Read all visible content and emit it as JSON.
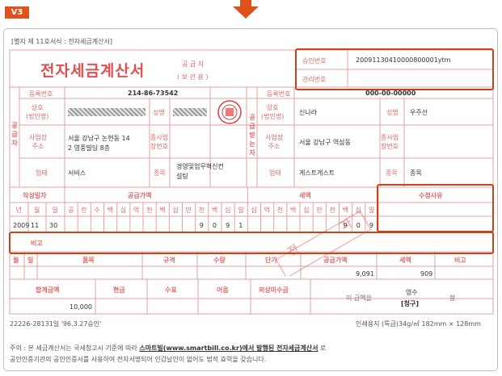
{
  "badge": "V3",
  "form_caption": "[별지 제 11호서식 : 전자세금계산서]",
  "title": "전자세금계산서",
  "supplier_header": {
    "line1": "공 급 자",
    "line2": "( 보 관 용 )"
  },
  "approval": {
    "approval_label": "승인번호",
    "approval_value": "20091130410000800001ytm",
    "manage_label": "관리번호",
    "manage_value": ""
  },
  "supplier": {
    "side_label": "공급자",
    "reg_label": "등록번호",
    "reg_value": "214-86-73542",
    "name_label": "상호\n(법인명)",
    "rep_label": "성명",
    "addr_label": "사업장\n주소",
    "addr_value": "서울 강남구 논현동 14\n2 영풍빌딩 8층",
    "branch_label": "종사업\n장번호",
    "type_label": "업태",
    "type_value": "서비스",
    "item_label": "종목",
    "item_value": "경영및업무혁신컨\n설팅"
  },
  "buyer": {
    "side_label": "공급받는자",
    "reg_label": "등록번호",
    "reg_value": "000-00-00000",
    "name_label": "상호\n(법인명)",
    "name_value": "신나라",
    "rep_label": "성명",
    "rep_value": "우주선",
    "addr_label": "사업장\n주소",
    "addr_value": "서울 강남구 역삼동",
    "branch_label": "종사업\n장번호",
    "type_label": "업태",
    "type_value": "게스트게스트",
    "item_label": "종목",
    "item_value": "종목"
  },
  "amount_header": {
    "date": "작성일자",
    "supply": "공급가액",
    "tax": "세액",
    "revision": "수정사유"
  },
  "date_cols": [
    "년",
    "월",
    "일"
  ],
  "digit_cols": [
    "공",
    "란",
    "수",
    "백",
    "십",
    "억",
    "천",
    "백",
    "십",
    "만",
    "천",
    "백",
    "십",
    "일",
    "십",
    "억",
    "천",
    "백",
    "십",
    "만",
    "천",
    "백",
    "십",
    "일"
  ],
  "date_values": [
    "2009",
    "11",
    "30"
  ],
  "supply_digits": [
    "9",
    "0",
    "9",
    "1"
  ],
  "tax_digits": [
    "9",
    "0",
    "9"
  ],
  "remarks_label": "비고",
  "items_header": {
    "month": "월",
    "day": "일",
    "item": "품목",
    "spec": "규격",
    "qty": "수량",
    "price": "단가",
    "supply": "공급가액",
    "tax": "세액",
    "note": "비고"
  },
  "items_row": {
    "supply": "9,091",
    "tax": "909"
  },
  "totals_header": {
    "total": "합계금액",
    "cash": "현금",
    "check": "수표",
    "note": "어음",
    "credit": "외상미수금"
  },
  "totals_row": {
    "total": "10,000",
    "phrase": "이 금액을",
    "receipt": "영수",
    "claim": "[청구]",
    "suffix": "함"
  },
  "doc_number": "22226-28131일 '96.3.27승인'",
  "paper_spec": "인쇄용지 (특급)34g/㎡ 182mm × 128mm",
  "footer": {
    "line1_pre": "주의 : 본 세금계산서는 국세청고시 기준에 따라 ",
    "line1_bold": "스마트빌(www.smartbill.co.kr)에서 발행된 전자세금계산서",
    "line1_post": " 로",
    "line2": "공인인증기관의 공인인증서를 사용하여 전자서명되어 인감날인이 없어도 법적 효력을 갖습니다."
  },
  "watermark_chars": [
    "자",
    "전"
  ],
  "colors": {
    "accent": "#e05050",
    "highlight": "#c8431a",
    "grid": "#e7a0a0"
  }
}
